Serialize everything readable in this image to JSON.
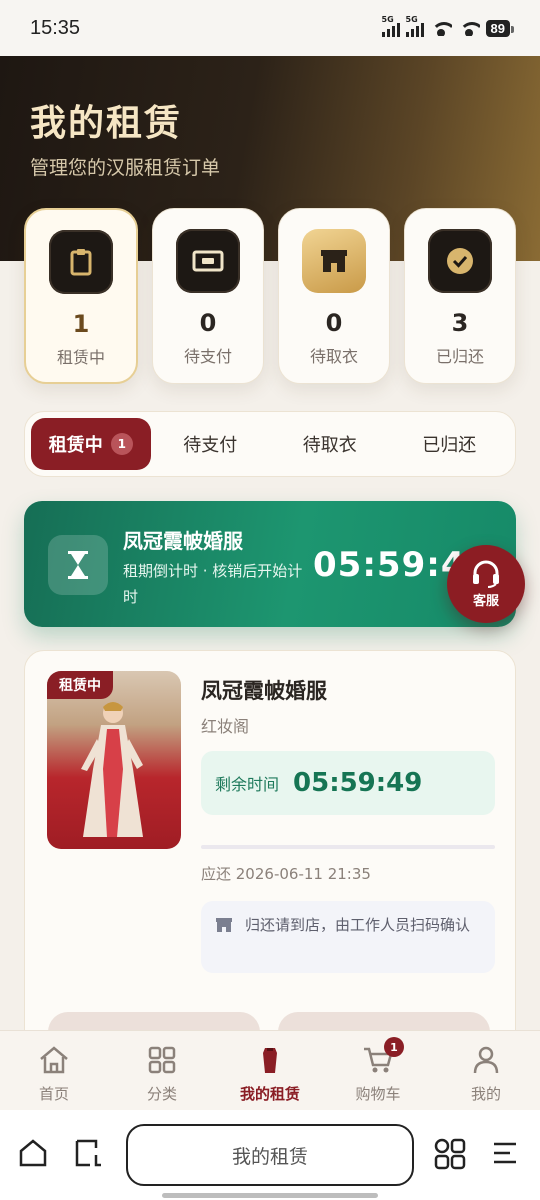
{
  "status_bar": {
    "time": "15:35",
    "signal_1": "5G",
    "signal_2": "5G",
    "battery": "89"
  },
  "header": {
    "title": "我的租赁",
    "subtitle": "管理您的汉服租赁订单"
  },
  "stats": [
    {
      "count": "1",
      "label": "租赁中",
      "icon": "clipboard-icon"
    },
    {
      "count": "0",
      "label": "待支付",
      "icon": "wallet-icon"
    },
    {
      "count": "0",
      "label": "待取衣",
      "icon": "store-icon"
    },
    {
      "count": "3",
      "label": "已归还",
      "icon": "check-icon"
    }
  ],
  "tabs": [
    {
      "label": "租赁中",
      "badge": "1"
    },
    {
      "label": "待支付"
    },
    {
      "label": "待取衣"
    },
    {
      "label": "已归还"
    }
  ],
  "countdown_banner": {
    "name": "凤冠霞帔婚服",
    "desc": "租期倒计时 · 核销后开始计时",
    "time": "05:59:49"
  },
  "customer_service": {
    "label": "客服"
  },
  "order": {
    "tag": "租赁中",
    "name": "凤冠霞帔婚服",
    "shop": "红妆阁",
    "remaining_label": "剩余时间",
    "remaining_time": "05:59:49",
    "due": "应还 2026-06-11 21:35",
    "notice": "归还请到店，由工作人员扫码确认"
  },
  "bottom_nav": [
    {
      "label": "首页",
      "icon": "home-icon"
    },
    {
      "label": "分类",
      "icon": "grid-icon"
    },
    {
      "label": "我的租赁",
      "icon": "robe-icon"
    },
    {
      "label": "购物车",
      "icon": "cart-icon",
      "badge": "1"
    },
    {
      "label": "我的",
      "icon": "user-icon"
    }
  ],
  "browser": {
    "address": "我的租赁"
  },
  "colors": {
    "accent_red": "#8a1e25",
    "green": "#1d9670",
    "gold": "#d8b56d",
    "dark": "#1d1814"
  }
}
